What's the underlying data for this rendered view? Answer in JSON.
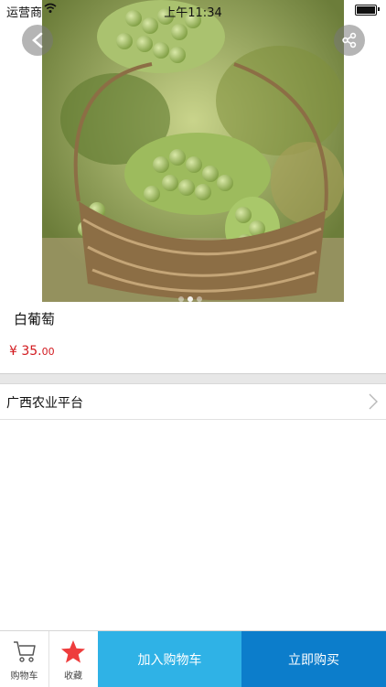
{
  "status_bar": {
    "carrier": "运营商",
    "time": "上午11:34"
  },
  "product": {
    "name": "白葡萄",
    "price_symbol": "¥",
    "price_int": " 35.",
    "price_dec": "00",
    "image_icon": "grapes-in-basket-photo",
    "carousel_dots": 3,
    "carousel_active": 1
  },
  "store": {
    "name": "广西农业平台"
  },
  "bottom_bar": {
    "cart_label": "购物车",
    "favorite_label": "收藏",
    "add_to_cart_label": "加入购物车",
    "buy_now_label": "立即购买"
  },
  "colors": {
    "price": "#d2191e",
    "favorite_star": "#ee3d3d",
    "add_to_cart": "#2fb2e6",
    "buy_now": "#0c7dcb"
  }
}
